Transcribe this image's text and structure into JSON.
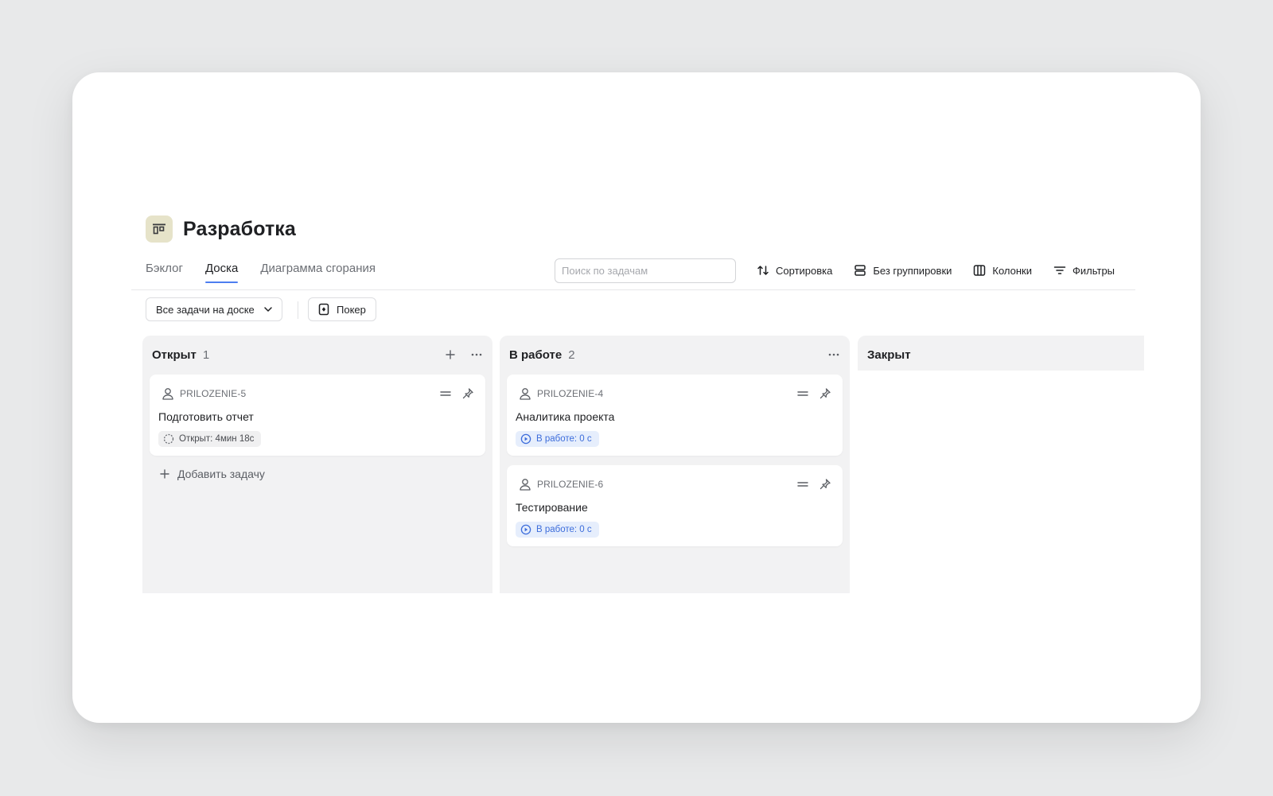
{
  "board": {
    "title": "Разработка",
    "icon": "board-icon"
  },
  "tabs": [
    {
      "label": "Бэклог",
      "active": false
    },
    {
      "label": "Доска",
      "active": true
    },
    {
      "label": "Диаграмма сгорания",
      "active": false
    }
  ],
  "search": {
    "placeholder": "Поиск по задачам",
    "value": ""
  },
  "toolbar": {
    "sort_label": "Сортировка",
    "group_label": "Без группировки",
    "columns_label": "Колонки",
    "filters_label": "Фильтры"
  },
  "filter": {
    "selected": "Все задачи на доске",
    "poker_label": "Покер"
  },
  "columns": {
    "open": {
      "title": "Открыт",
      "count": "1",
      "cards": [
        {
          "key": "PRILOZENIE-5",
          "title": "Подготовить отчет",
          "status": "Открыт: 4мин 18с"
        }
      ],
      "add_label": "Добавить задачу"
    },
    "work": {
      "title": "В работе",
      "count": "2",
      "cards": [
        {
          "key": "PRILOZENIE-4",
          "title": "Аналитика проекта",
          "status": "В работе: 0 с"
        },
        {
          "key": "PRILOZENIE-6",
          "title": "Тестирование",
          "status": "В работе: 0 с"
        }
      ]
    },
    "closed": {
      "title": "Закрыт"
    }
  },
  "colors": {
    "accent": "#4d7ef0",
    "badge_blue_text": "#3d6ddb",
    "badge_blue_bg": "#e6eefc",
    "column_bg": "#f2f2f3",
    "board_icon_bg": "#e6e3c9"
  }
}
